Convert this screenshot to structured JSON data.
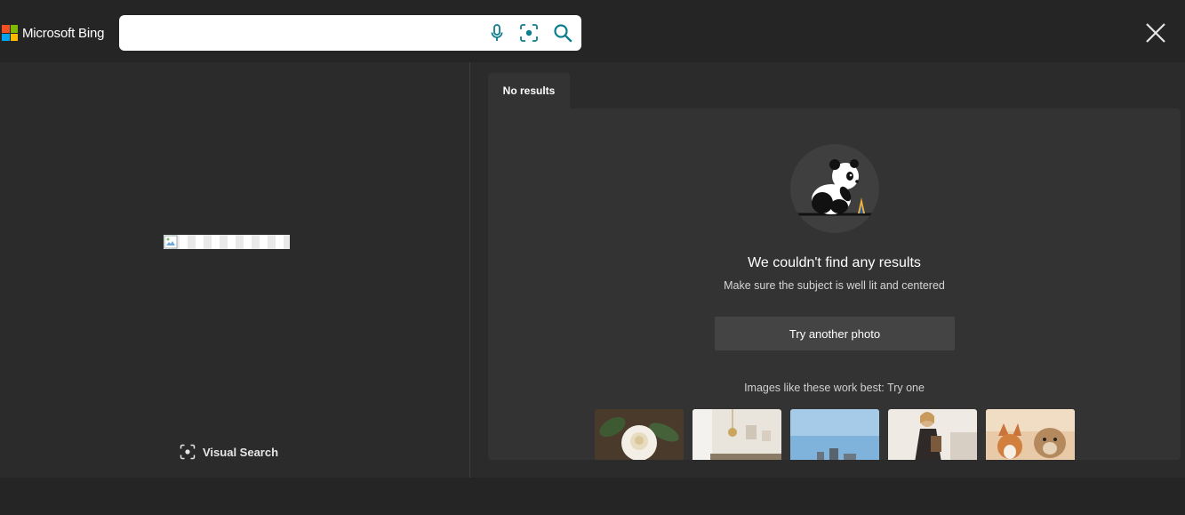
{
  "header": {
    "logo_text": "Microsoft Bing",
    "logo_colors": [
      "#f25022",
      "#7fba00",
      "#00a4ef",
      "#ffb900"
    ],
    "search": {
      "value": "",
      "placeholder": ""
    },
    "icons": [
      "microphone-icon",
      "visual-search-icon",
      "search-icon",
      "close-icon"
    ],
    "accent": "#0c7d8c"
  },
  "left_pane": {
    "visual_search_label": "Visual Search"
  },
  "right_pane": {
    "tab_label": "No results",
    "title": "We couldn't find any results",
    "subtitle": "Make sure the subject is well lit and centered",
    "try_button": "Try another photo",
    "examples_label": "Images like these work best: Try one",
    "examples": [
      "rose",
      "interior",
      "sky",
      "person",
      "dogs"
    ]
  }
}
